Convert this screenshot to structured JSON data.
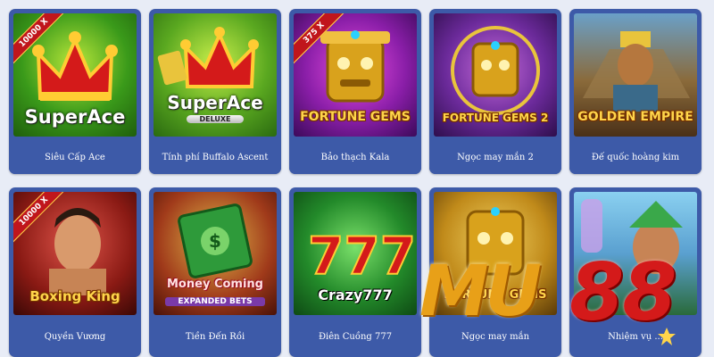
{
  "games": [
    {
      "title": "Siêu Cấp Ace",
      "logo": "SuperAce",
      "badge": "10000 X",
      "theme": "green"
    },
    {
      "title": "Tính phí Buffalo Ascent",
      "logo": "SuperAce",
      "sub": "DELUXE",
      "theme": "green"
    },
    {
      "title": "Bảo thạch Kala",
      "logo": "FORTUNE GEMS",
      "badge": "375 X",
      "theme": "purple"
    },
    {
      "title": "Ngọc may mắn 2",
      "logo": "FORTUNE GEMS 2",
      "theme": "purple2"
    },
    {
      "title": "Đế quốc hoàng kim",
      "logo": "GOLDEN EMPIRE",
      "theme": "gold"
    },
    {
      "title": "Quyền Vương",
      "logo": "Boxing King",
      "badge": "10000 X",
      "theme": "red"
    },
    {
      "title": "Tiền Đến Rồi",
      "logo": "Money Coming",
      "sub": "EXPANDED BETS",
      "theme": "greenred"
    },
    {
      "title": "Điên Cuồng 777",
      "logo": "Crazy777",
      "theme": "green2"
    },
    {
      "title": "Ngọc may mắn",
      "logo": "FORTUNE GEMS",
      "theme": "gold2"
    },
    {
      "title": "Nhiệm vụ ... ",
      "logo": "",
      "theme": "sky"
    }
  ],
  "watermark": {
    "text1": "MU",
    "text2": "88"
  },
  "colors": {
    "card": "#3d5aa8",
    "background": "#e8ecf6",
    "accent": "#ffd54a"
  }
}
